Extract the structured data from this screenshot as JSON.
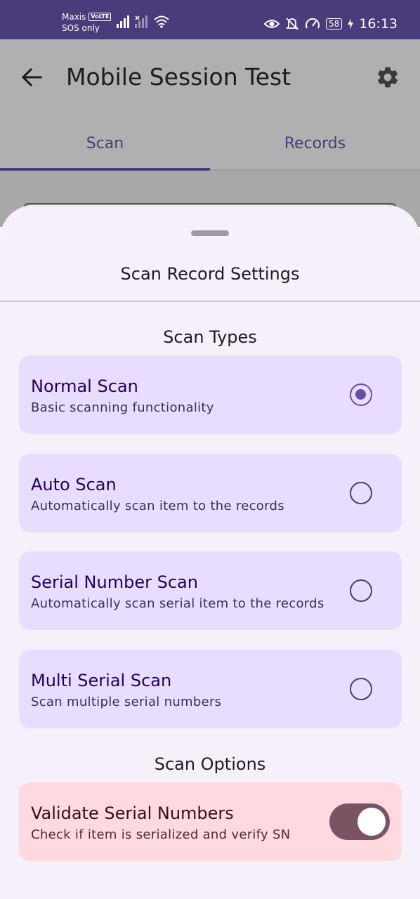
{
  "status_bar": {
    "carrier": "Maxis",
    "volte": "VoLTE",
    "sos": "SOS only",
    "battery": "58",
    "time": "16:13",
    "icons": [
      "eye-icon",
      "bell-off-icon",
      "speed-icon",
      "battery-icon",
      "charging-icon"
    ]
  },
  "app_bar": {
    "title": "Mobile Session Test",
    "icons": [
      "back-arrow-icon",
      "gear-icon"
    ]
  },
  "tabs": [
    {
      "label": "Scan",
      "selected": true
    },
    {
      "label": "Records",
      "selected": false
    }
  ],
  "sheet": {
    "title": "Scan Record Settings",
    "scan_types_title": "Scan Types",
    "scan_types": [
      {
        "label": "Normal Scan",
        "description": "Basic scanning functionality",
        "selected": true
      },
      {
        "label": "Auto Scan",
        "description": "Automatically scan item to the records",
        "selected": false
      },
      {
        "label": "Serial Number Scan",
        "description": "Automatically scan serial item to the records",
        "selected": false
      },
      {
        "label": "Multi Serial Scan",
        "description": "Scan multiple serial numbers",
        "selected": false
      }
    ],
    "scan_options_title": "Scan Options",
    "scan_options": [
      {
        "label": "Validate Serial Numbers",
        "description": "Check if item is serialized and verify SN",
        "enabled": true
      }
    ]
  },
  "colors": {
    "status_bar": "#4a3b7a",
    "accent": "#6750a4",
    "card": "#e9ddff",
    "option_card": "#ffd9e0",
    "switch_track": "#7b5463"
  }
}
